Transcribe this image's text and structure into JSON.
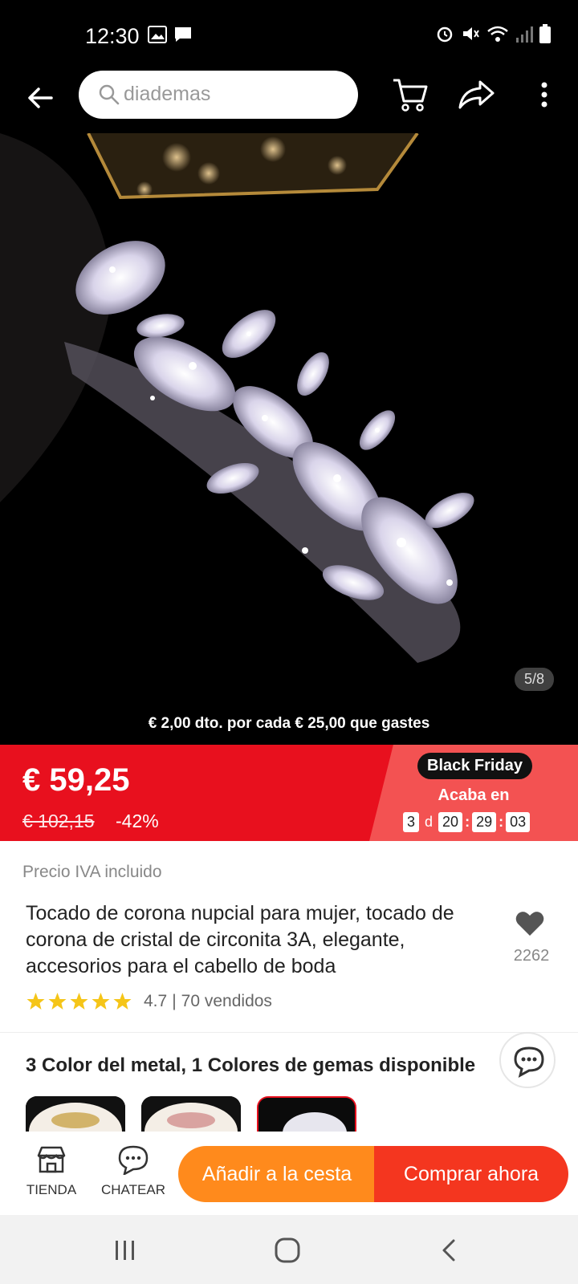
{
  "status_bar": {
    "time": "12:30"
  },
  "header": {
    "search_value": "diademas"
  },
  "product": {
    "image_counter": "5/8",
    "promo": "€ 2,00 dto. por cada € 25,00 que gastes",
    "price": "€ 59,25",
    "old_price": "€ 102,15",
    "discount": "-42%",
    "event_badge": "Black Friday",
    "ends_label": "Acaba en",
    "countdown": {
      "days": "3",
      "day_unit": "d",
      "hours": "20",
      "minutes": "29",
      "seconds": "03"
    },
    "vat_note": "Precio IVA incluido",
    "title": "Tocado de corona nupcial para mujer, tocado de corona de cristal de circonita 3A, elegante, accesorios para el cabello de boda",
    "favorites": "2262",
    "rating": "4.7",
    "sold": "70 vendidos",
    "variant_summary": "3 Color del metal, 1 Colores de gemas disponible"
  },
  "bottom_bar": {
    "store_label": "TIENDA",
    "chat_label": "CHATEAR",
    "add_to_cart": "Añadir a la cesta",
    "buy_now": "Comprar ahora"
  },
  "colors": {
    "price_red": "#e8101e",
    "cart_orange": "#ff8a1c",
    "buy_red": "#f4361f",
    "star": "#f5c518"
  }
}
